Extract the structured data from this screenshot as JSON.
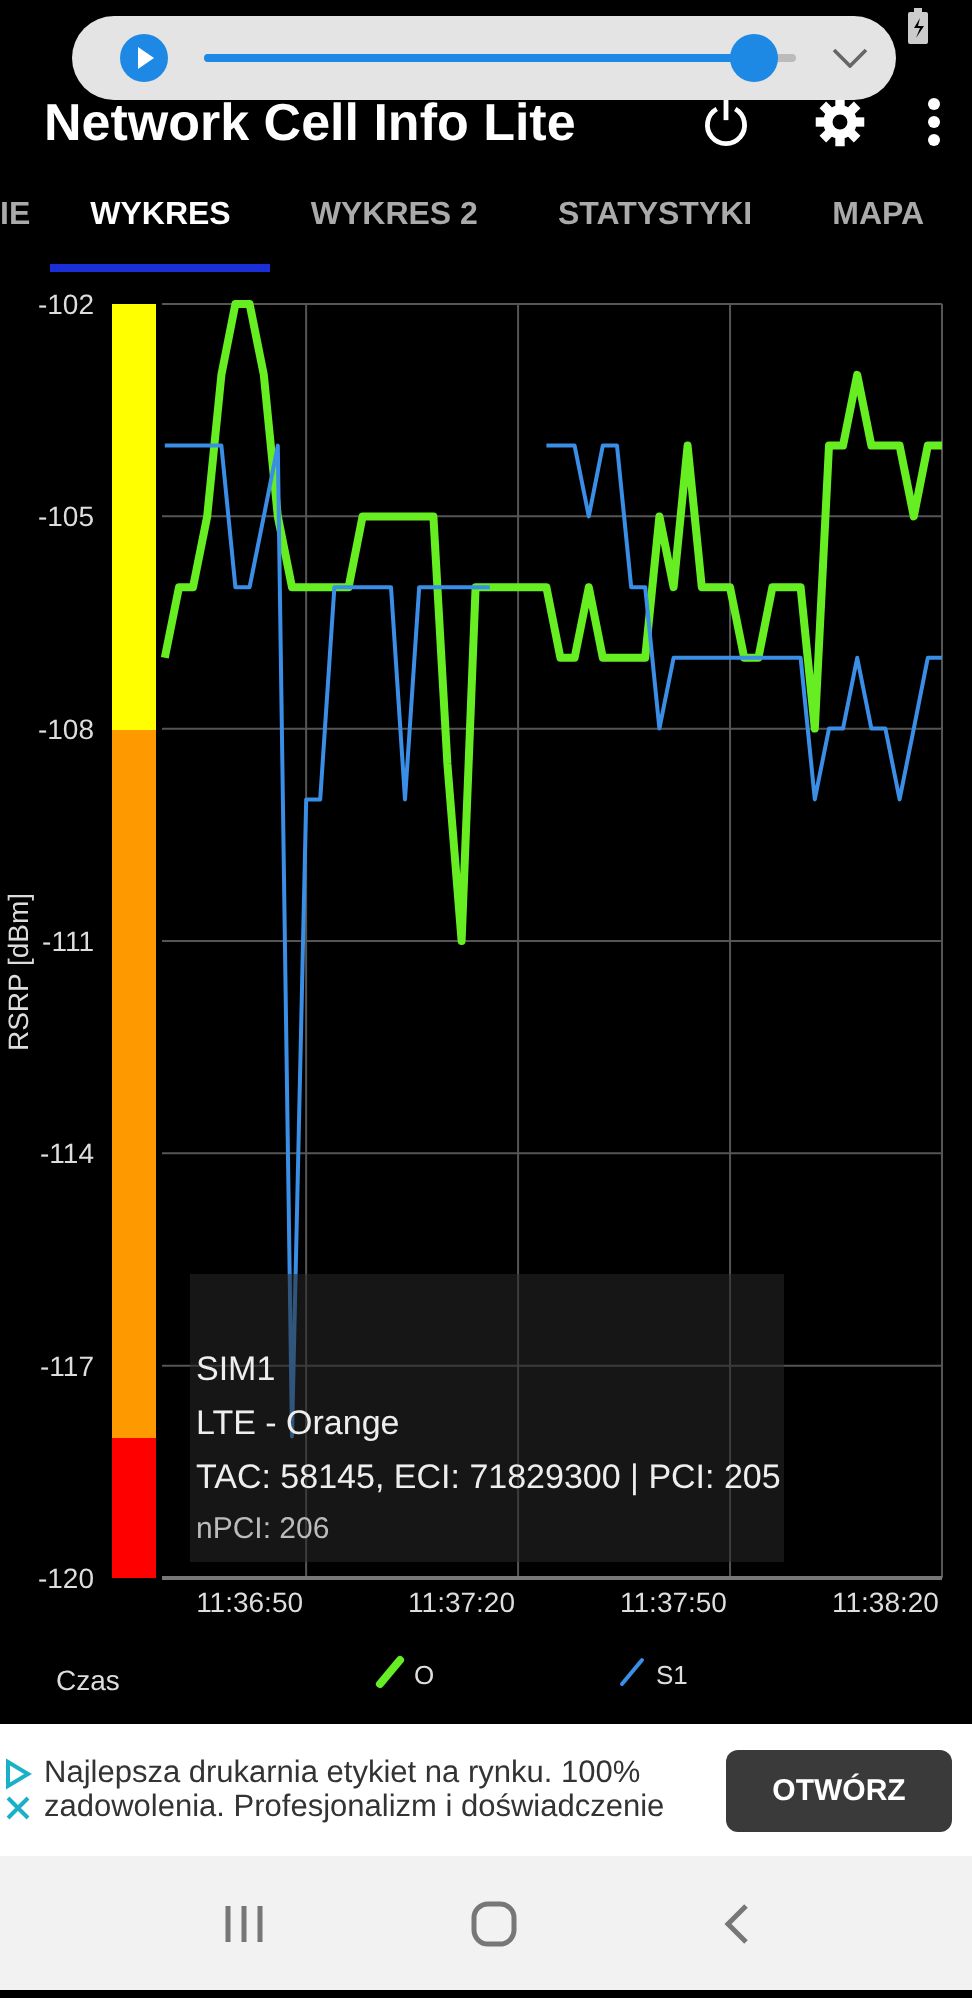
{
  "media_overlay": {
    "level": 0.93
  },
  "app_bar": {
    "title": "Network Cell Info Lite"
  },
  "tabs": [
    {
      "label": "IE",
      "selected": false
    },
    {
      "label": "WYKRES",
      "selected": true
    },
    {
      "label": "WYKRES 2",
      "selected": false
    },
    {
      "label": "STATYSTYKI",
      "selected": false
    },
    {
      "label": "MAPA",
      "selected": false
    }
  ],
  "chart": {
    "chart_data": {
      "type": "line",
      "xlabel": "Czas",
      "ylabel": "RSRP [dBm]",
      "categories": [
        null,
        null,
        null,
        null,
        null,
        null,
        "11:36:50",
        null,
        null,
        null,
        null,
        null,
        null,
        null,
        null,
        null,
        null,
        null,
        null,
        null,
        null,
        "11:37:20",
        null,
        null,
        null,
        null,
        null,
        null,
        null,
        null,
        null,
        null,
        null,
        null,
        null,
        null,
        "11:37:50",
        null,
        null,
        null,
        null,
        null,
        null,
        null,
        null,
        null,
        null,
        null,
        null,
        null,
        null,
        "11:38:20",
        null,
        null,
        null,
        null
      ],
      "grid": true,
      "legend": "bottom",
      "series": [
        {
          "name": "O",
          "color": "#66ee22",
          "values": [
            -107,
            -106,
            -106,
            -105,
            -103,
            -102,
            -102,
            -103,
            -105,
            -106,
            -106,
            -106,
            -106,
            -106,
            -105,
            -105,
            -105,
            -105,
            -105,
            -105,
            -108.5,
            -111,
            -106,
            -106,
            -106,
            -106,
            -106,
            -106,
            -107,
            -107,
            -106,
            -107,
            -107,
            -107,
            -107,
            -105,
            -106,
            -104,
            -106,
            -106,
            -106,
            -107,
            -107,
            -106,
            -106,
            -106,
            -108,
            -104,
            -104,
            -103,
            -104,
            -104,
            -104,
            -105,
            -104,
            -104
          ]
        },
        {
          "name": "S1",
          "color": "#3a8ee6",
          "values": [
            -104,
            -104,
            -104,
            -104,
            -104,
            -106,
            -106,
            -105,
            -104,
            -118,
            -109,
            -109,
            -106,
            -106,
            -106,
            -106,
            -106,
            -109,
            -106,
            -106,
            -106,
            -106,
            -106,
            -106,
            null,
            null,
            null,
            -104,
            -104,
            -104,
            -105,
            -104,
            -104,
            -106,
            -106,
            -108,
            -107,
            -107,
            -107,
            -107,
            -107,
            -107,
            -107,
            -107,
            -107,
            -107,
            -109,
            -108,
            -108,
            -107,
            -108,
            -108,
            -109,
            -108,
            -107,
            -107
          ]
        }
      ],
      "ylim": [
        -120,
        -102
      ],
      "yticks": [
        -102,
        -105,
        -108,
        -111,
        -114,
        -117,
        -120
      ]
    },
    "info": [
      "SIM1",
      "LTE - Orange",
      "TAC: 58145, ECI: 71829300 | PCI: 205",
      "nPCI: 206"
    ]
  },
  "ad": {
    "text": "Najlepsza drukarnia etykiet na rynku. 100% zadowolenia. Profesjonalizm i doświadczenie",
    "button": "OTWÓRZ"
  }
}
